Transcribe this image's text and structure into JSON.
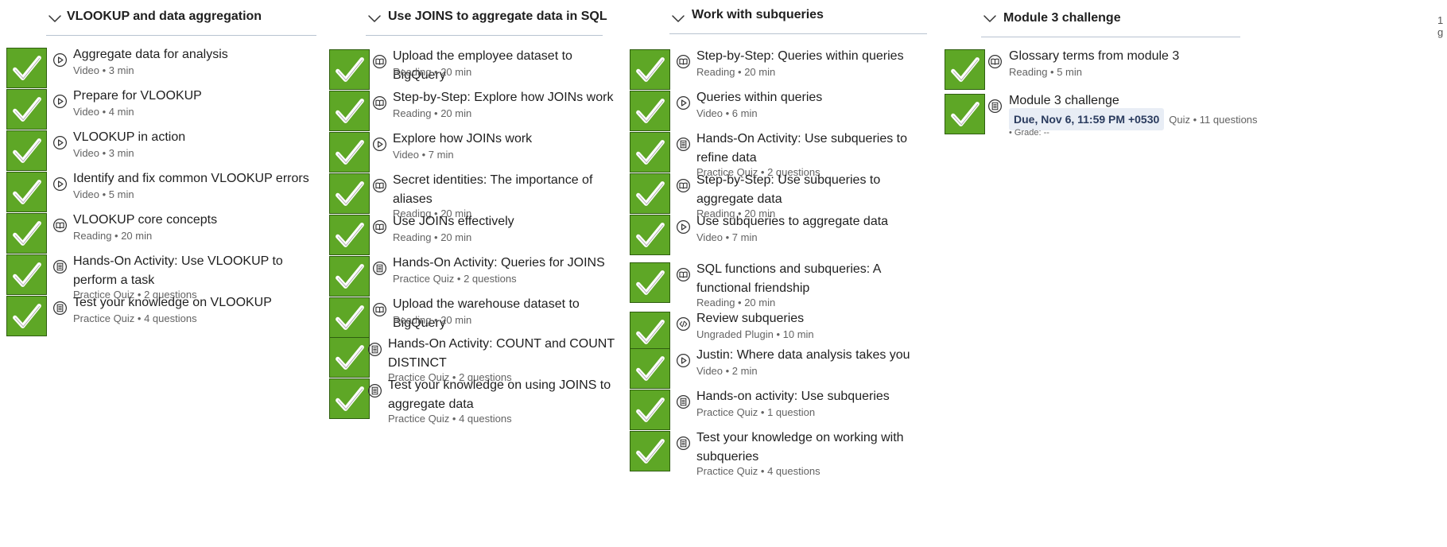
{
  "columns": [
    {
      "title": "VLOOKUP and data aggregation",
      "items": [
        {
          "title": "Aggregate data for analysis",
          "meta": "Video • 3 min",
          "icon": "video"
        },
        {
          "title": "Prepare for VLOOKUP",
          "meta": "Video • 4 min",
          "icon": "video"
        },
        {
          "title": "VLOOKUP in action",
          "meta": "Video • 3 min",
          "icon": "video"
        },
        {
          "title": "Identify and fix common VLOOKUP errors",
          "meta": "Video • 5 min",
          "icon": "video"
        },
        {
          "title": "VLOOKUP core concepts",
          "meta": "Reading • 20 min",
          "icon": "reading"
        },
        {
          "title": "Hands-On Activity: Use VLOOKUP to perform a task",
          "meta": "Practice Quiz • 2 questions",
          "icon": "quiz"
        },
        {
          "title": "Test your knowledge on VLOOKUP",
          "meta": "Practice Quiz • 4 questions",
          "icon": "quiz"
        }
      ]
    },
    {
      "title": "Use JOINS to aggregate data in SQL",
      "items": [
        {
          "title": "Upload the employee dataset to BigQuery",
          "meta": "Reading • 20 min",
          "icon": "reading"
        },
        {
          "title": "Step-by-Step: Explore how JOINs work",
          "meta": "Reading • 20 min",
          "icon": "reading"
        },
        {
          "title": "Explore how JOINs work",
          "meta": "Video • 7 min",
          "icon": "video"
        },
        {
          "title": "Secret identities: The importance of aliases",
          "meta": "Reading • 20 min",
          "icon": "reading"
        },
        {
          "title": "Use JOINs effectively",
          "meta": "Reading • 20 min",
          "icon": "reading"
        },
        {
          "title": "Hands-On Activity: Queries for JOINS",
          "meta": "Practice Quiz • 2 questions",
          "icon": "quiz"
        },
        {
          "title": "Upload the warehouse dataset to BigQuery",
          "meta": "Reading • 20 min",
          "icon": "reading"
        },
        {
          "title": "Hands-On Activity: COUNT and COUNT DISTINCT",
          "meta": "Practice Quiz • 2 questions",
          "icon": "quiz"
        },
        {
          "title": "Test your knowledge on using JOINS to aggregate data",
          "meta": "Practice Quiz • 4 questions",
          "icon": "quiz"
        }
      ]
    },
    {
      "title": "Work with subqueries",
      "items": [
        {
          "title": "Step-by-Step: Queries within queries",
          "meta": "Reading • 20 min",
          "icon": "reading"
        },
        {
          "title": "Queries within queries",
          "meta": "Video • 6 min",
          "icon": "video"
        },
        {
          "title": "Hands-On Activity: Use subqueries to refine data",
          "meta": "Practice Quiz • 2 questions",
          "icon": "quiz"
        },
        {
          "title": "Step-by-Step: Use subqueries to aggregate data",
          "meta": "Reading • 20 min",
          "icon": "reading"
        },
        {
          "title": "Use subqueries to aggregate data",
          "meta": "Video • 7 min",
          "icon": "video"
        },
        {
          "title": "SQL functions and subqueries: A functional friendship",
          "meta": "Reading • 20 min",
          "icon": "reading"
        },
        {
          "title": "Review subqueries",
          "meta": "Ungraded Plugin • 10 min",
          "icon": "plugin"
        },
        {
          "title": "Justin: Where data analysis takes you",
          "meta": "Video • 2 min",
          "icon": "video"
        },
        {
          "title": "Hands-on activity: Use subqueries",
          "meta": "Practice Quiz • 1 question",
          "icon": "quiz"
        },
        {
          "title": "Test your knowledge on working with subqueries",
          "meta": "Practice Quiz • 4 questions",
          "icon": "quiz"
        }
      ]
    },
    {
      "title": "Module 3 challenge",
      "items": [
        {
          "title": "Glossary terms from module 3",
          "meta": "Reading • 5 min",
          "icon": "reading"
        },
        {
          "title": "Module 3 challenge",
          "due": "Due, Nov 6, 11:59 PM +0530",
          "meta": "Quiz • 11 questions",
          "grade": "• Grade: --",
          "icon": "quiz"
        }
      ]
    }
  ],
  "topright_text": "1 g"
}
